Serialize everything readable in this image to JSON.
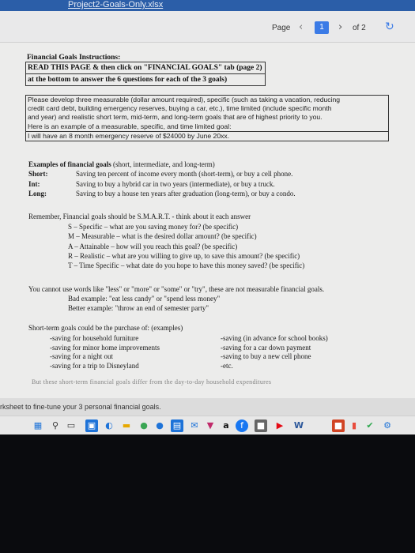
{
  "window": {
    "file_name": "Project2-Goals-Only.xlsx"
  },
  "toolbar": {
    "page_label": "Page",
    "prev_icon": "chevron-left-icon",
    "current_page": "1",
    "next_icon": "chevron-right-icon",
    "page_total": "of 2",
    "refresh_icon": "refresh-icon",
    "accent_color": "#3b7be6"
  },
  "instructions": {
    "title": "Financial Goals Instructions:",
    "lines": [
      "READ THIS PAGE & then click on \"FINANCIAL GOALS\" tab (page 2)",
      "at the bottom to answer the 6 questions for each of the 3 goals)"
    ]
  },
  "goal_box": {
    "lines": [
      "Please develop three measurable (dollar amount required), specific (such as taking a vacation, reducing",
      "credit card debt, building emergency reserves, buying a car, etc.), time limited (include specific month",
      "and year) and realistic short term, mid-term, and long-term goals that are of highest priority to you.",
      "Here is an example of a measurable, specific, and time limited goal:"
    ],
    "example": "I will have an 8 month emergency reserve of $24000 by June 20xx."
  },
  "examples": {
    "header_bold": "Examples of financial goals",
    "header_rest": " (short, intermediate, and long-term)",
    "rows": [
      {
        "term": "Short:",
        "text": "Saving ten percent of income every month (short-term), or buy a cell phone."
      },
      {
        "term": "Int:",
        "text": "Saving to buy a hybrid car in two years (intermediate), or buy a truck."
      },
      {
        "term": "Long:",
        "text": "Saving to buy a house ten years after graduation (long-term), or buy a condo."
      }
    ]
  },
  "smart": {
    "intro": "Remember, Financial goals should be S.M.A.R.T. - think about it each answer",
    "items": [
      "S – Specific – what are you saving money for? (be specific)",
      "M – Measurable – what is the desired dollar amount? (be specific)",
      "A – Attainable – how will you reach this goal? (be specific)",
      "R – Realistic – what are you willing to give up, to save this amount? (be specific)",
      "T – Time Specific – what date do you hope to have this money saved? (be specific)"
    ]
  },
  "words": {
    "line1": "You cannot use words like \"less\" or \"more\" or \"some\" or \"try\", these are not measurable financial goals.",
    "bad": "Bad example: \"eat less candy\" or \"spend less money\"",
    "better": "Better example: \"throw an end of semester party\""
  },
  "short_term": {
    "intro": "Short-term goals could be the purchase of: (examples)",
    "col1": [
      "-saving for household furniture",
      "-saving for minor home improvements",
      "-saving for a night out",
      "-saving for a trip to Disneyland"
    ],
    "col2": [
      "-saving (in advance for school books)",
      "-saving for a car down payment",
      "-saving to buy a new cell phone",
      "-etc."
    ]
  },
  "cutoff_text": "But these short-term financial goals differ from the day-to-day household expenditures",
  "status_text": "rksheet to fine-tune your 3 personal financial goals.",
  "taskbar": {
    "icons": [
      "windows-start-icon",
      "search-icon",
      "task-view-icon",
      "file-explorer-icon",
      "edge-icon",
      "folder-icon",
      "chrome-icon",
      "store-icon",
      "calendar-icon",
      "mail-icon",
      "amazon-icon",
      "facebook-icon",
      "media-icon",
      "netflix-icon",
      "word-icon",
      "office-icon",
      "vpn-icon",
      "check-icon",
      "settings-icon"
    ],
    "amazon_label": "a",
    "word_label": "W"
  }
}
